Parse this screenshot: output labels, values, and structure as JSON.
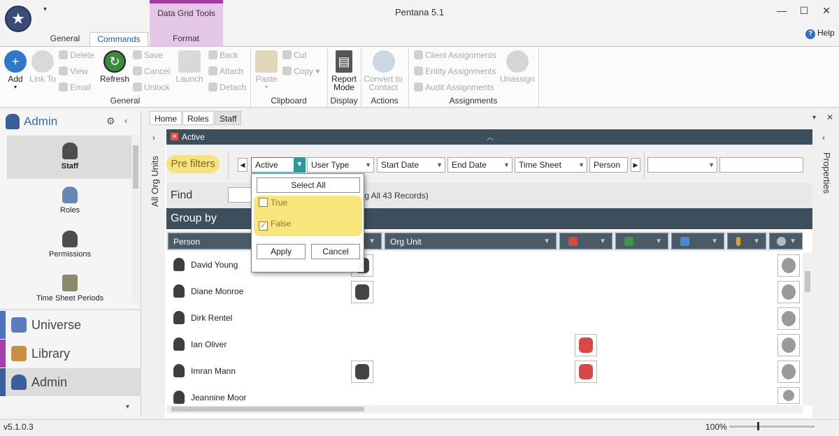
{
  "app": {
    "title": "Pentana 5.1",
    "version": "v5.1.0.3",
    "help_label": "Help"
  },
  "contextual_group": {
    "title": "Data Grid Tools",
    "color": "#a23ea3"
  },
  "tabs": [
    "General",
    "Commands",
    "Format"
  ],
  "ribbon": {
    "general": {
      "label": "General",
      "add": "Add",
      "link_to": "Link To",
      "refresh": "Refresh",
      "delete": "Delete",
      "view": "View",
      "email": "Email",
      "save": "Save",
      "cancel": "Cancel",
      "unlock": "Unlock",
      "launch": "Launch",
      "back": "Back",
      "attach": "Attach",
      "detach": "Detach"
    },
    "clipboard": {
      "label": "Clipboard",
      "paste": "Paste",
      "cut": "Cut",
      "copy": "Copy"
    },
    "display": {
      "label": "Display",
      "report_mode": "Report Mode"
    },
    "actions": {
      "label": "Actions",
      "convert_to_contact": "Convert to Contact"
    },
    "assignments": {
      "label": "Assignments",
      "client": "Client Assignments",
      "entity": "Entity Assignments",
      "audit": "Audit Assignments",
      "unassign": "Unassign"
    }
  },
  "leftnav": {
    "title": "Admin",
    "items": [
      "Staff",
      "Roles",
      "Permissions",
      "Time Sheet Periods"
    ],
    "sections": [
      {
        "label": "Universe",
        "color": "#4f6fbf"
      },
      {
        "label": "Library",
        "color": "#a040a8"
      },
      {
        "label": "Admin",
        "color": "#3a5f9a"
      }
    ]
  },
  "doctabs": [
    "Home",
    "Roles",
    "Staff"
  ],
  "side_panes": {
    "left": "All Org Units",
    "right": "Properties"
  },
  "filter_bar": {
    "title": "Active"
  },
  "prefilters": {
    "badge": "Pre filters",
    "combos": [
      "Active",
      "User Type",
      "Start Date",
      "End Date",
      "Time Sheet",
      "Person"
    ]
  },
  "dropdown": {
    "select_all": "Select All",
    "options": [
      {
        "label": "True",
        "checked": false
      },
      {
        "label": "False",
        "checked": true
      }
    ],
    "apply": "Apply",
    "cancel": "Cancel"
  },
  "find": {
    "label": "Find",
    "count_text": "ing All 43 Records)"
  },
  "groupby": {
    "label": "Group by"
  },
  "grid": {
    "columns": [
      "Person",
      "Org Unit"
    ],
    "rows": [
      {
        "name": "David Young"
      },
      {
        "name": "Diane Monroe"
      },
      {
        "name": "Dirk Rentel"
      },
      {
        "name": "Ian Oliver"
      },
      {
        "name": "Imran Mann"
      },
      {
        "name": "Jeannine Moor"
      }
    ]
  },
  "zoom": {
    "label": "100%",
    "value": 0.33
  }
}
